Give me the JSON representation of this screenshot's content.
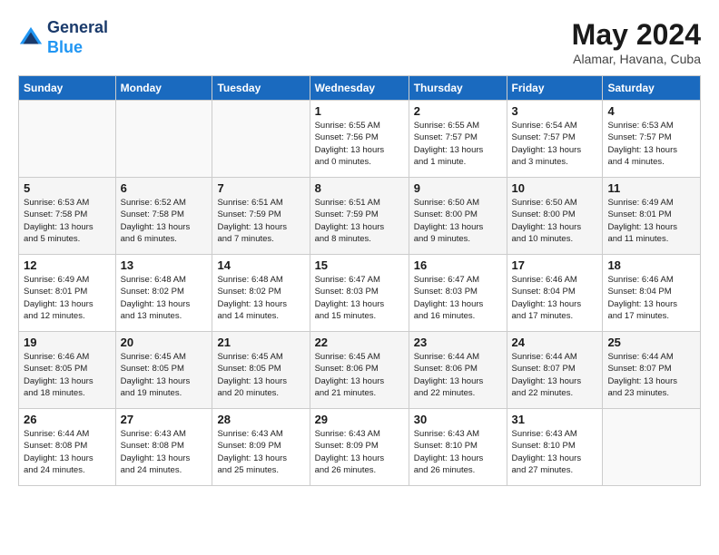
{
  "header": {
    "logo_line1": "General",
    "logo_line2": "Blue",
    "month": "May 2024",
    "location": "Alamar, Havana, Cuba"
  },
  "days_of_week": [
    "Sunday",
    "Monday",
    "Tuesday",
    "Wednesday",
    "Thursday",
    "Friday",
    "Saturday"
  ],
  "weeks": [
    [
      {
        "day": "",
        "info": ""
      },
      {
        "day": "",
        "info": ""
      },
      {
        "day": "",
        "info": ""
      },
      {
        "day": "1",
        "info": "Sunrise: 6:55 AM\nSunset: 7:56 PM\nDaylight: 13 hours\nand 0 minutes."
      },
      {
        "day": "2",
        "info": "Sunrise: 6:55 AM\nSunset: 7:57 PM\nDaylight: 13 hours\nand 1 minute."
      },
      {
        "day": "3",
        "info": "Sunrise: 6:54 AM\nSunset: 7:57 PM\nDaylight: 13 hours\nand 3 minutes."
      },
      {
        "day": "4",
        "info": "Sunrise: 6:53 AM\nSunset: 7:57 PM\nDaylight: 13 hours\nand 4 minutes."
      }
    ],
    [
      {
        "day": "5",
        "info": "Sunrise: 6:53 AM\nSunset: 7:58 PM\nDaylight: 13 hours\nand 5 minutes."
      },
      {
        "day": "6",
        "info": "Sunrise: 6:52 AM\nSunset: 7:58 PM\nDaylight: 13 hours\nand 6 minutes."
      },
      {
        "day": "7",
        "info": "Sunrise: 6:51 AM\nSunset: 7:59 PM\nDaylight: 13 hours\nand 7 minutes."
      },
      {
        "day": "8",
        "info": "Sunrise: 6:51 AM\nSunset: 7:59 PM\nDaylight: 13 hours\nand 8 minutes."
      },
      {
        "day": "9",
        "info": "Sunrise: 6:50 AM\nSunset: 8:00 PM\nDaylight: 13 hours\nand 9 minutes."
      },
      {
        "day": "10",
        "info": "Sunrise: 6:50 AM\nSunset: 8:00 PM\nDaylight: 13 hours\nand 10 minutes."
      },
      {
        "day": "11",
        "info": "Sunrise: 6:49 AM\nSunset: 8:01 PM\nDaylight: 13 hours\nand 11 minutes."
      }
    ],
    [
      {
        "day": "12",
        "info": "Sunrise: 6:49 AM\nSunset: 8:01 PM\nDaylight: 13 hours\nand 12 minutes."
      },
      {
        "day": "13",
        "info": "Sunrise: 6:48 AM\nSunset: 8:02 PM\nDaylight: 13 hours\nand 13 minutes."
      },
      {
        "day": "14",
        "info": "Sunrise: 6:48 AM\nSunset: 8:02 PM\nDaylight: 13 hours\nand 14 minutes."
      },
      {
        "day": "15",
        "info": "Sunrise: 6:47 AM\nSunset: 8:03 PM\nDaylight: 13 hours\nand 15 minutes."
      },
      {
        "day": "16",
        "info": "Sunrise: 6:47 AM\nSunset: 8:03 PM\nDaylight: 13 hours\nand 16 minutes."
      },
      {
        "day": "17",
        "info": "Sunrise: 6:46 AM\nSunset: 8:04 PM\nDaylight: 13 hours\nand 17 minutes."
      },
      {
        "day": "18",
        "info": "Sunrise: 6:46 AM\nSunset: 8:04 PM\nDaylight: 13 hours\nand 17 minutes."
      }
    ],
    [
      {
        "day": "19",
        "info": "Sunrise: 6:46 AM\nSunset: 8:05 PM\nDaylight: 13 hours\nand 18 minutes."
      },
      {
        "day": "20",
        "info": "Sunrise: 6:45 AM\nSunset: 8:05 PM\nDaylight: 13 hours\nand 19 minutes."
      },
      {
        "day": "21",
        "info": "Sunrise: 6:45 AM\nSunset: 8:05 PM\nDaylight: 13 hours\nand 20 minutes."
      },
      {
        "day": "22",
        "info": "Sunrise: 6:45 AM\nSunset: 8:06 PM\nDaylight: 13 hours\nand 21 minutes."
      },
      {
        "day": "23",
        "info": "Sunrise: 6:44 AM\nSunset: 8:06 PM\nDaylight: 13 hours\nand 22 minutes."
      },
      {
        "day": "24",
        "info": "Sunrise: 6:44 AM\nSunset: 8:07 PM\nDaylight: 13 hours\nand 22 minutes."
      },
      {
        "day": "25",
        "info": "Sunrise: 6:44 AM\nSunset: 8:07 PM\nDaylight: 13 hours\nand 23 minutes."
      }
    ],
    [
      {
        "day": "26",
        "info": "Sunrise: 6:44 AM\nSunset: 8:08 PM\nDaylight: 13 hours\nand 24 minutes."
      },
      {
        "day": "27",
        "info": "Sunrise: 6:43 AM\nSunset: 8:08 PM\nDaylight: 13 hours\nand 24 minutes."
      },
      {
        "day": "28",
        "info": "Sunrise: 6:43 AM\nSunset: 8:09 PM\nDaylight: 13 hours\nand 25 minutes."
      },
      {
        "day": "29",
        "info": "Sunrise: 6:43 AM\nSunset: 8:09 PM\nDaylight: 13 hours\nand 26 minutes."
      },
      {
        "day": "30",
        "info": "Sunrise: 6:43 AM\nSunset: 8:10 PM\nDaylight: 13 hours\nand 26 minutes."
      },
      {
        "day": "31",
        "info": "Sunrise: 6:43 AM\nSunset: 8:10 PM\nDaylight: 13 hours\nand 27 minutes."
      },
      {
        "day": "",
        "info": ""
      }
    ]
  ]
}
